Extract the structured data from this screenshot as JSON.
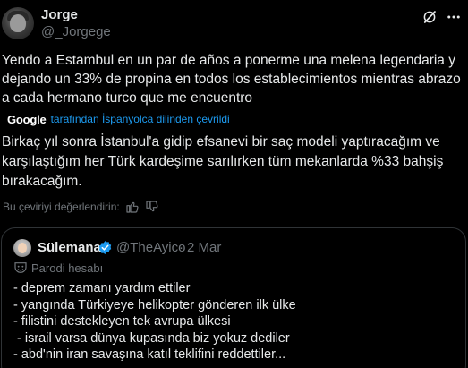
{
  "author": {
    "name": "Jorge",
    "handle": "@_Jorgege"
  },
  "post": {
    "original_text": "Yendo a Estambul en un par de años a ponerme una melena legendaria y dejando un 33% de propina en todos los establecimientos mientras abrazo a cada hermano turco que me encuentro",
    "translation_provider": "Google",
    "translation_note": "tarafından İspanyolca dilinden çevrildi",
    "translated_text": "Birkaç yıl sonra İstanbul'a gidip efsanevi bir saç modeli yaptıracağım ve karşılaştığım her Türk kardeşime sarılırken tüm mekanlarda %33 bahşiş bırakacağım.",
    "rate_label": "Bu çeviriyi değerlendirin:"
  },
  "quote": {
    "name": "Sülemana",
    "handle": "@TheAyico",
    "separator": "·",
    "date": "2 Mar",
    "parody_label": "Parodi hesabı",
    "lines": [
      "- deprem zamanı yardım ettiler",
      "- yangında Türkiyeye helikopter gönderen ilk ülke",
      "- filistini destekleyen tek avrupa ülkesi",
      " - israil varsa dünya kupasında biz yokuz dediler",
      "- abd'nin iran savaşına katıl teklifini reddettiler..."
    ]
  },
  "colors": {
    "background": "#000000",
    "text": "#e7e9ea",
    "secondary": "#71767b",
    "link": "#1d9bf0",
    "border": "#2f3336"
  },
  "icons": [
    "grok-icon",
    "more-icon",
    "thumbs-up-icon",
    "thumbs-down-icon",
    "verified-badge-icon",
    "parody-mask-icon"
  ]
}
